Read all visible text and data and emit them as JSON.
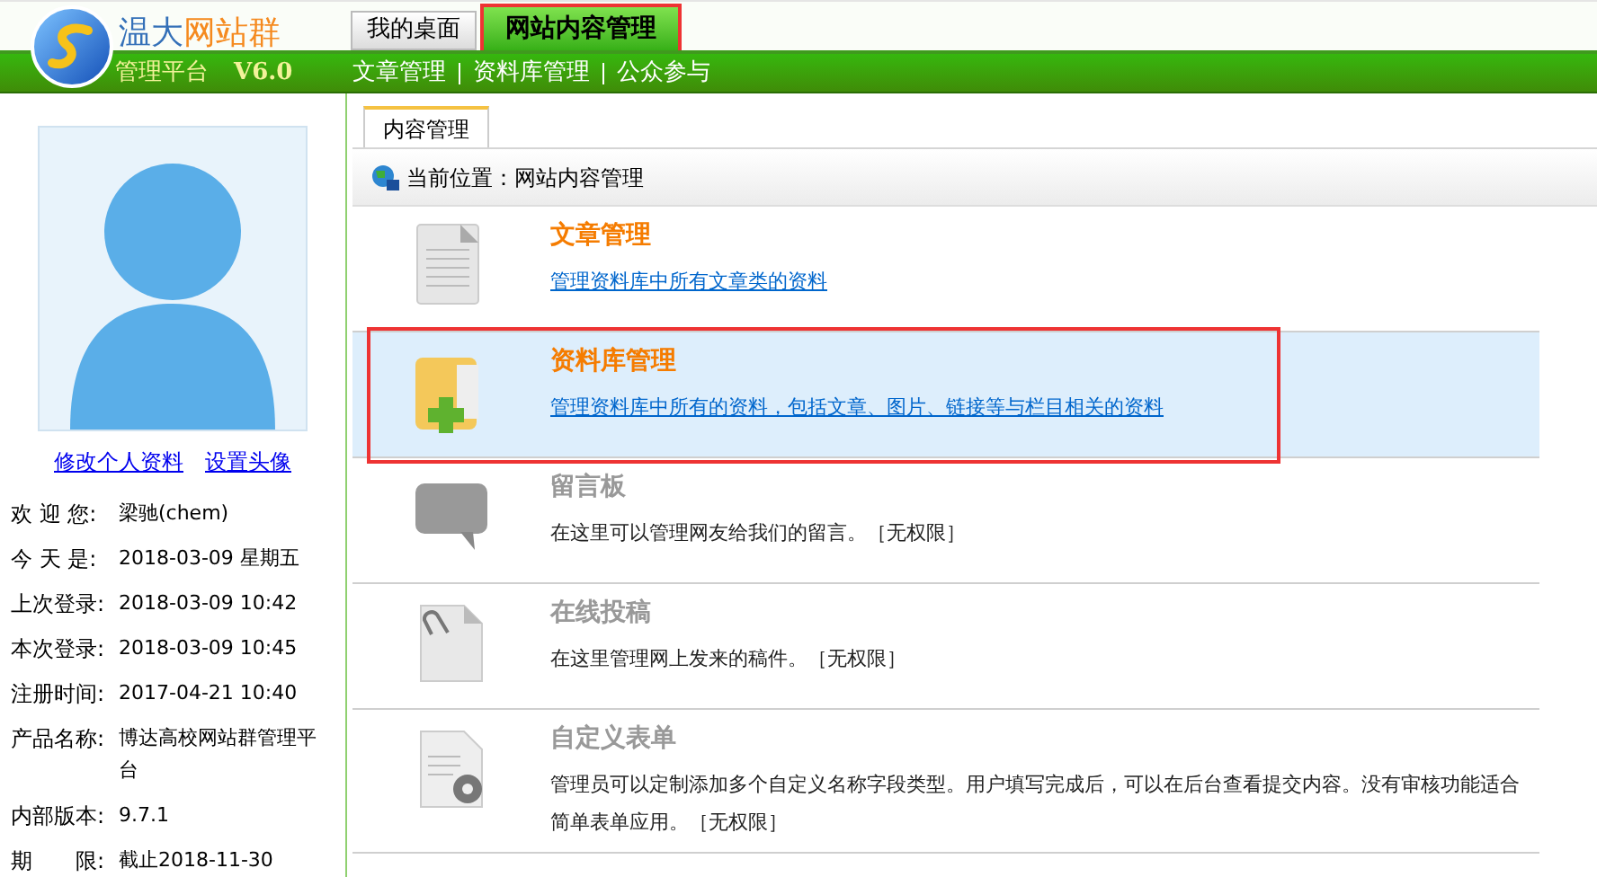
{
  "logo": {
    "title_part1": "温大",
    "title_part2": "网站群",
    "subtitle": "管理平台",
    "version": "V6.0"
  },
  "top_tabs": [
    {
      "label": "我的桌面",
      "selected": false,
      "highlighted": false
    },
    {
      "label": "网站内容管理",
      "selected": true,
      "highlighted": true
    }
  ],
  "sub_nav": [
    "文章管理",
    "资料库管理",
    "公众参与"
  ],
  "sidebar": {
    "links": [
      "修改个人资料",
      "设置头像"
    ],
    "info": [
      {
        "label": "欢 迎 您:",
        "value": "梁驰(chem)"
      },
      {
        "label": "今 天 是:",
        "value": "2018-03-09 星期五"
      },
      {
        "label": "上次登录:",
        "value": "2018-03-09 10:42"
      },
      {
        "label": "本次登录:",
        "value": "2018-03-09 10:45"
      },
      {
        "label": "注册时间:",
        "value": "2017-04-21 10:40"
      },
      {
        "label": "产品名称:",
        "value": "博达高校网站群管理平台"
      },
      {
        "label": "内部版本:",
        "value": "9.7.1"
      },
      {
        "label": "期　　限:",
        "value": "截止2018-11-30"
      }
    ]
  },
  "panel_tab": "内容管理",
  "breadcrumb": "当前位置：网站内容管理",
  "items": [
    {
      "kind": "document",
      "title": "文章管理",
      "description": "管理资料库中所有文章类的资料",
      "disabled": false,
      "selected": false,
      "highlighted": false
    },
    {
      "kind": "folder",
      "title": "资料库管理",
      "description": "管理资料库中所有的资料，包括文章、图片、链接等与栏目相关的资料",
      "disabled": false,
      "selected": true,
      "highlighted": true
    },
    {
      "kind": "chat",
      "title": "留言板",
      "description": "在这里可以管理网友给我们的留言。［无权限］",
      "disabled": true,
      "selected": false,
      "highlighted": false
    },
    {
      "kind": "clip",
      "title": "在线投稿",
      "description": "在这里管理网上发来的稿件。［无权限］",
      "disabled": true,
      "selected": false,
      "highlighted": false
    },
    {
      "kind": "form",
      "title": "自定义表单",
      "description": "管理员可以定制添加多个自定义名称字段类型。用户填写完成后，可以在后台查看提交内容。没有审核功能适合简单表单应用。［无权限］",
      "disabled": true,
      "selected": false,
      "highlighted": false
    }
  ]
}
